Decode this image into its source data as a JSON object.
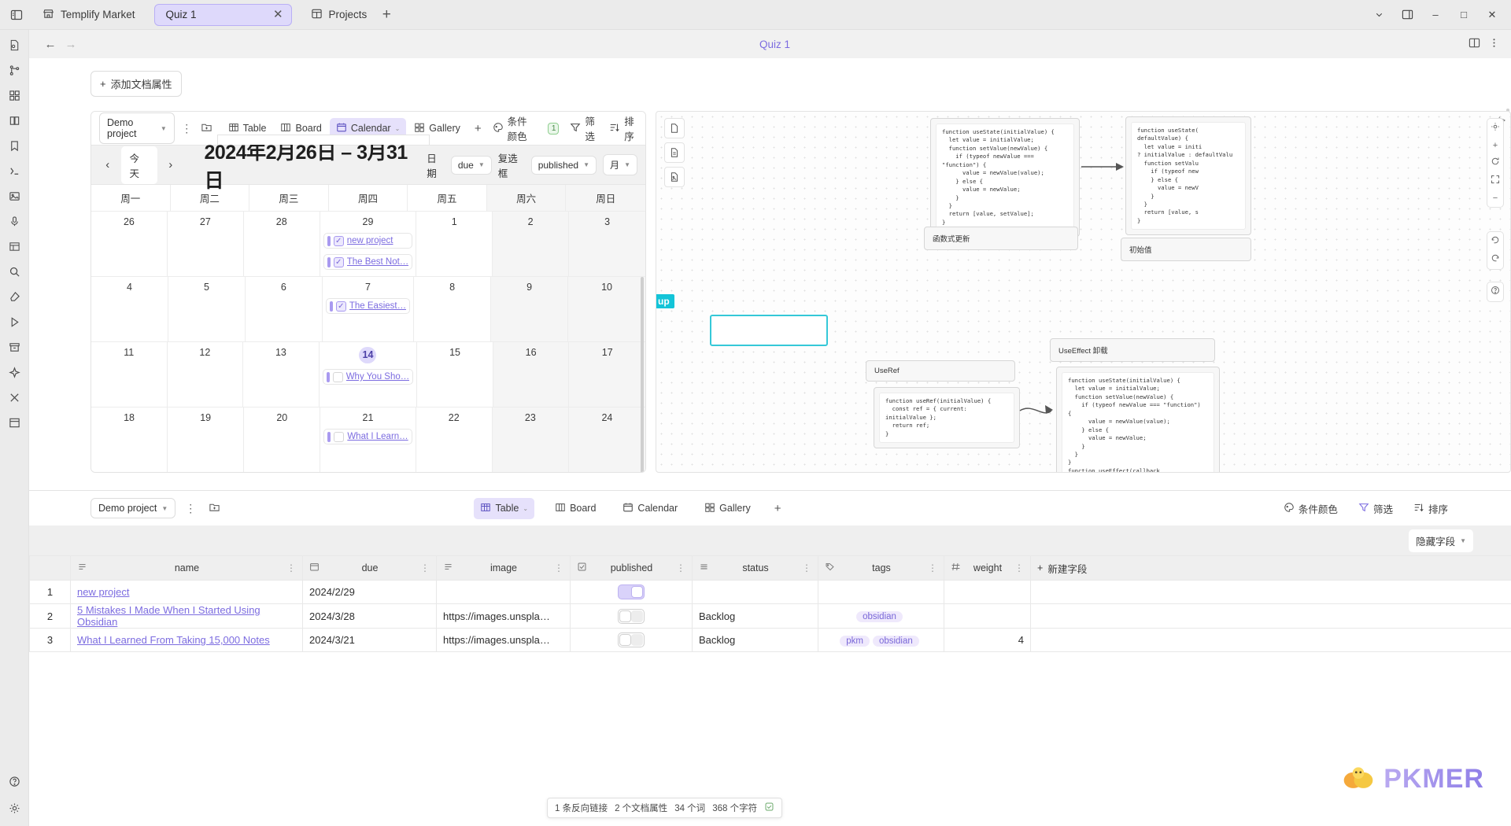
{
  "titlebar": {
    "sidebar_toggle_icon": "sidebar-toggle-icon",
    "tabs": [
      {
        "label": "Templify Market",
        "icon": "store-icon",
        "active": false
      },
      {
        "label": "Quiz 1",
        "icon": "",
        "active": true,
        "close": "✕"
      },
      {
        "label": "Projects",
        "icon": "layout-icon",
        "active": false
      }
    ],
    "new_tab": "+",
    "chevron_down": "⌄",
    "panel_icon": "panel-right-icon",
    "minimize": "–",
    "maximize": "□",
    "close": "✕"
  },
  "dochead": {
    "back": "←",
    "forward": "→",
    "title": "Quiz 1",
    "split_icon": "split-view-icon",
    "more_icon": "more-vertical-icon"
  },
  "doc": {
    "add_property": "添加文档属性",
    "add_property_plus": "+"
  },
  "calendar_view": {
    "project_selector": "Demo project",
    "more": "⋮",
    "new_doc_icon": "new-doc-icon",
    "tabs": [
      {
        "label": "Table",
        "icon": "table-icon",
        "active": false
      },
      {
        "label": "Board",
        "icon": "board-icon",
        "active": true,
        "is_board": true
      },
      {
        "label": "Calendar",
        "icon": "calendar-icon",
        "active": true,
        "caret": "⌄"
      },
      {
        "label": "Gallery",
        "icon": "gallery-icon",
        "active": false
      }
    ],
    "add_view": "+",
    "conditional_color": "条件颜色",
    "conditional_color_count": "1",
    "filter": "筛选",
    "sort": "排序",
    "prev": "‹",
    "today": "今天",
    "next": "›",
    "title": "2024年2月26日 – 3月31日",
    "date_label": "日期",
    "date_field": "due",
    "checkbox_label": "复选框",
    "checkbox_field": "published",
    "range": "月",
    "dow": [
      "周一",
      "周二",
      "周三",
      "周四",
      "周五",
      "周六",
      "周日"
    ],
    "weeks": [
      {
        "days": [
          {
            "num": "26",
            "events": []
          },
          {
            "num": "27",
            "events": []
          },
          {
            "num": "28",
            "events": []
          },
          {
            "num": "29",
            "events": [
              {
                "title": "new project",
                "checked": true,
                "bar": true
              },
              {
                "title": "The Best Not…",
                "checked": true,
                "bar": true
              }
            ]
          },
          {
            "num": "1",
            "events": []
          },
          {
            "num": "2",
            "events": []
          },
          {
            "num": "3",
            "events": []
          }
        ]
      },
      {
        "days": [
          {
            "num": "4",
            "events": []
          },
          {
            "num": "5",
            "events": []
          },
          {
            "num": "6",
            "events": []
          },
          {
            "num": "7",
            "events": [
              {
                "title": "The Easiest…",
                "checked": true,
                "bar": true
              }
            ]
          },
          {
            "num": "8",
            "events": []
          },
          {
            "num": "9",
            "events": []
          },
          {
            "num": "10",
            "events": []
          }
        ]
      },
      {
        "days": [
          {
            "num": "11",
            "events": []
          },
          {
            "num": "12",
            "events": []
          },
          {
            "num": "13",
            "events": []
          },
          {
            "num": "14",
            "today": true,
            "events": [
              {
                "title": "Why You Sho…",
                "checked": false,
                "bar": true
              }
            ]
          },
          {
            "num": "15",
            "events": []
          },
          {
            "num": "16",
            "events": []
          },
          {
            "num": "17",
            "events": []
          }
        ]
      },
      {
        "days": [
          {
            "num": "18",
            "events": []
          },
          {
            "num": "19",
            "events": []
          },
          {
            "num": "20",
            "events": []
          },
          {
            "num": "21",
            "events": [
              {
                "title": "What I Learn…",
                "checked": false,
                "bar": true
              }
            ]
          },
          {
            "num": "22",
            "events": []
          },
          {
            "num": "23",
            "events": []
          },
          {
            "num": "24",
            "events": []
          }
        ]
      }
    ]
  },
  "canvas": {
    "code_toggle": "</>",
    "cards": [
      {
        "id": "usestate-1",
        "label": "函数式更新"
      },
      {
        "id": "usestate-2",
        "label": "初始值"
      },
      {
        "id": "useref",
        "label": "UseRef"
      },
      {
        "id": "useeffect",
        "label": "UseEffect 卸载"
      }
    ],
    "code_usestate": "function useState(initialValue) {\n  let value = initialValue;\n  function setValue(newValue) {\n    if (typeof newValue ===\n\"function\") {\n      value = newValue(value);\n    } else {\n      value = newValue;\n    }\n  }\n  return [value, setValue];\n}",
    "code_usestate_default": "function useState(\ndefaultValue) {\n  let value = initi\n? initialValue : defaultValu\n  function setValu\n    if (typeof new\n    } else {\n      value = newV\n    }\n  }\n  return [value, s\n}",
    "code_useref": "function useRef(initialValue) {\n  const ref = { current:\ninitialValue };\n  return ref;\n}",
    "code_useeffect": "function useState(initialValue) {\n  let value = initialValue;\n  function setValue(newValue) {\n    if (typeof newValue === \"function\")\n{\n      value = newValue(value);\n    } else {\n      value = newValue;\n    }\n  }\n}\nfunction useEffect(callback,",
    "teal_label": "up",
    "tools_right": [
      "gear-icon",
      "plus-icon",
      "refresh-icon",
      "fullscreen-icon",
      "minus-icon"
    ],
    "tools_history": [
      "undo-icon",
      "redo-icon"
    ],
    "tools_help": [
      "help-icon"
    ],
    "tools_left": [
      "file-icon",
      "file-text-icon",
      "file-image-icon"
    ]
  },
  "table_view": {
    "project_selector": "Demo project",
    "more": "⋮",
    "new_doc_icon": "new-doc-icon",
    "tabs": [
      {
        "label": "Table",
        "icon": "table-icon",
        "active": true,
        "caret": "⌄"
      },
      {
        "label": "Board",
        "icon": "board-icon",
        "active": false
      },
      {
        "label": "Calendar",
        "icon": "calendar-icon",
        "active": false
      },
      {
        "label": "Gallery",
        "icon": "gallery-icon",
        "active": false
      }
    ],
    "add_view": "+",
    "conditional_color": "条件颜色",
    "filter": "筛选",
    "sort": "排序",
    "hidden_fields": "隐藏字段",
    "columns": [
      {
        "label": "name",
        "icon": "text-icon"
      },
      {
        "label": "due",
        "icon": "calendar-icon"
      },
      {
        "label": "image",
        "icon": "text-icon"
      },
      {
        "label": "published",
        "icon": "checkbox-icon"
      },
      {
        "label": "status",
        "icon": "select-icon"
      },
      {
        "label": "tags",
        "icon": "tag-icon"
      },
      {
        "label": "weight",
        "icon": "number-icon"
      }
    ],
    "new_field": "新建字段",
    "new_field_plus": "+",
    "rows": [
      {
        "num": "1",
        "name": "new project",
        "due": "2024/2/29",
        "image": "",
        "published": true,
        "status": "",
        "tags": [],
        "weight": ""
      },
      {
        "num": "2",
        "name": "5 Mistakes I Made When I Started Using Obsidian",
        "due": "2024/3/28",
        "image": "https://images.unspla…",
        "published": false,
        "status": "Backlog",
        "tags": [
          "obsidian"
        ],
        "weight": ""
      },
      {
        "num": "3",
        "name": "What I Learned From Taking 15,000 Notes",
        "due": "2024/3/21",
        "image": "https://images.unspla…",
        "published": false,
        "status": "Backlog",
        "tags": [
          "pkm",
          "obsidian"
        ],
        "weight": "4"
      }
    ]
  },
  "statusbar": {
    "backlinks": "1 条反向链接",
    "properties": "2 个文档属性",
    "words": "34 个词",
    "chars": "368 个字符",
    "icon": "checkbox-doc-icon"
  },
  "watermark": {
    "text": "PKMER"
  },
  "colors": {
    "accent": "#7c6ce0",
    "accent_light": "#ded9fb",
    "titlebar_bg": "#ebebeb",
    "teal": "#13c4d8",
    "green_badge": "#4a8a4a"
  }
}
